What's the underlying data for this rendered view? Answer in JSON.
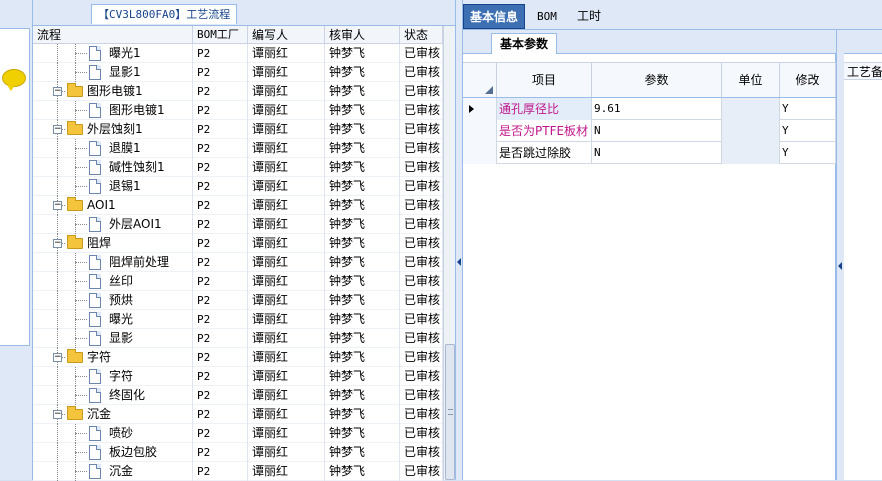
{
  "flow_panel": {
    "tab_label": "【CV3L800FA0】工艺流程",
    "columns": [
      "流程",
      "BOM工厂",
      "编写人",
      "核审人",
      "状态"
    ],
    "rows": [
      {
        "name": "曝光1",
        "type": "doc",
        "level": 2,
        "bom": "P2",
        "writer": "谭丽红",
        "reviewer": "钟梦飞",
        "status": "已审核"
      },
      {
        "name": "显影1",
        "type": "doc",
        "level": 2,
        "bom": "P2",
        "writer": "谭丽红",
        "reviewer": "钟梦飞",
        "status": "已审核"
      },
      {
        "name": "图形电镀1",
        "type": "folder",
        "level": 1,
        "bom": "P2",
        "writer": "谭丽红",
        "reviewer": "钟梦飞",
        "status": "已审核"
      },
      {
        "name": "图形电镀1",
        "type": "doc",
        "level": 2,
        "bom": "P2",
        "writer": "谭丽红",
        "reviewer": "钟梦飞",
        "status": "已审核"
      },
      {
        "name": "外层蚀刻1",
        "type": "folder",
        "level": 1,
        "bom": "P2",
        "writer": "谭丽红",
        "reviewer": "钟梦飞",
        "status": "已审核"
      },
      {
        "name": "退膜1",
        "type": "doc",
        "level": 2,
        "bom": "P2",
        "writer": "谭丽红",
        "reviewer": "钟梦飞",
        "status": "已审核"
      },
      {
        "name": "碱性蚀刻1",
        "type": "doc",
        "level": 2,
        "bom": "P2",
        "writer": "谭丽红",
        "reviewer": "钟梦飞",
        "status": "已审核"
      },
      {
        "name": "退锡1",
        "type": "doc",
        "level": 2,
        "bom": "P2",
        "writer": "谭丽红",
        "reviewer": "钟梦飞",
        "status": "已审核"
      },
      {
        "name": "AOI1",
        "type": "folder",
        "level": 1,
        "bom": "P2",
        "writer": "谭丽红",
        "reviewer": "钟梦飞",
        "status": "已审核"
      },
      {
        "name": "外层AOI1",
        "type": "doc",
        "level": 2,
        "bom": "P2",
        "writer": "谭丽红",
        "reviewer": "钟梦飞",
        "status": "已审核"
      },
      {
        "name": "阻焊",
        "type": "folder",
        "level": 1,
        "bom": "P2",
        "writer": "谭丽红",
        "reviewer": "钟梦飞",
        "status": "已审核"
      },
      {
        "name": "阻焊前处理",
        "type": "doc",
        "level": 2,
        "bom": "P2",
        "writer": "谭丽红",
        "reviewer": "钟梦飞",
        "status": "已审核"
      },
      {
        "name": "丝印",
        "type": "doc",
        "level": 2,
        "bom": "P2",
        "writer": "谭丽红",
        "reviewer": "钟梦飞",
        "status": "已审核"
      },
      {
        "name": "预烘",
        "type": "doc",
        "level": 2,
        "bom": "P2",
        "writer": "谭丽红",
        "reviewer": "钟梦飞",
        "status": "已审核"
      },
      {
        "name": "曝光",
        "type": "doc",
        "level": 2,
        "bom": "P2",
        "writer": "谭丽红",
        "reviewer": "钟梦飞",
        "status": "已审核"
      },
      {
        "name": "显影",
        "type": "doc",
        "level": 2,
        "bom": "P2",
        "writer": "谭丽红",
        "reviewer": "钟梦飞",
        "status": "已审核"
      },
      {
        "name": "字符",
        "type": "folder",
        "level": 1,
        "bom": "P2",
        "writer": "谭丽红",
        "reviewer": "钟梦飞",
        "status": "已审核"
      },
      {
        "name": "字符",
        "type": "doc",
        "level": 2,
        "bom": "P2",
        "writer": "谭丽红",
        "reviewer": "钟梦飞",
        "status": "已审核"
      },
      {
        "name": "终固化",
        "type": "doc",
        "level": 2,
        "bom": "P2",
        "writer": "谭丽红",
        "reviewer": "钟梦飞",
        "status": "已审核"
      },
      {
        "name": "沉金",
        "type": "folder",
        "level": 1,
        "bom": "P2",
        "writer": "谭丽红",
        "reviewer": "钟梦飞",
        "status": "已审核"
      },
      {
        "name": "喷砂",
        "type": "doc",
        "level": 2,
        "bom": "P2",
        "writer": "谭丽红",
        "reviewer": "钟梦飞",
        "status": "已审核"
      },
      {
        "name": "板边包胶",
        "type": "doc",
        "level": 2,
        "bom": "P2",
        "writer": "谭丽红",
        "reviewer": "钟梦飞",
        "status": "已审核"
      },
      {
        "name": "沉金",
        "type": "doc",
        "level": 2,
        "bom": "P2",
        "writer": "谭丽红",
        "reviewer": "钟梦飞",
        "status": "已审核"
      }
    ]
  },
  "main_tabs": {
    "basic_info": "基本信息",
    "bom": "BOM",
    "labor_hours": "工时"
  },
  "sub_tab": "基本参数",
  "param_grid": {
    "columns": [
      "项目",
      "参数",
      "单位",
      "修改"
    ],
    "rows": [
      {
        "item": "通孔厚径比",
        "value": "9.61",
        "unit": "",
        "modify": "Y",
        "pink": true,
        "selected": true
      },
      {
        "item": "是否为PTFE板材",
        "value": "N",
        "unit": "",
        "modify": "Y",
        "pink": true,
        "selected": false
      },
      {
        "item": "是否跳过除胶",
        "value": "N",
        "unit": "",
        "modify": "Y",
        "pink": false,
        "selected": false
      }
    ]
  },
  "far_panel": {
    "header": "工艺备注"
  },
  "colors": {
    "accent": "#3d6fb3",
    "border": "#99bbe8",
    "highlight_text": "#c0168a"
  }
}
